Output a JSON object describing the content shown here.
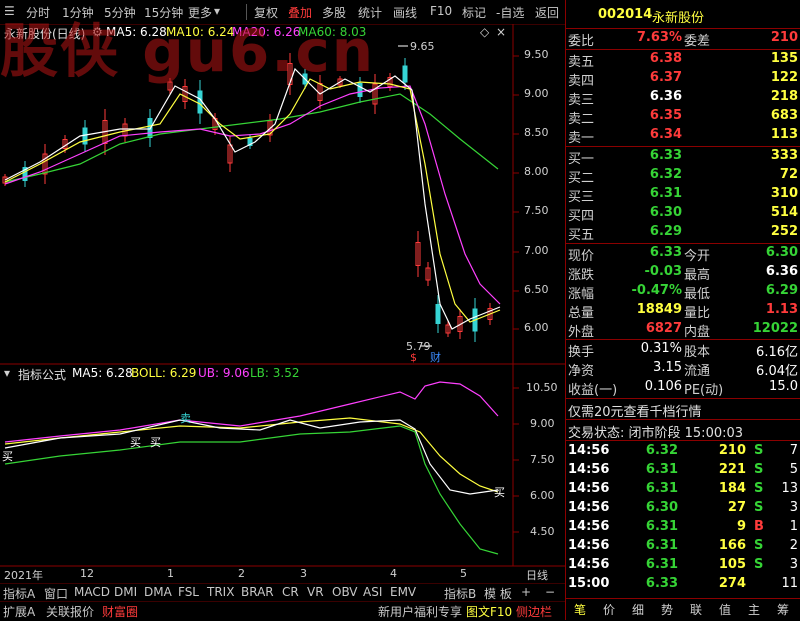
{
  "toolbar": {
    "items": [
      "分时",
      "1分钟",
      "5分钟",
      "15分钟",
      "更多",
      "复权",
      "叠加",
      "多股",
      "统计",
      "画线",
      "F10",
      "标记",
      "-自选",
      "返回"
    ]
  },
  "watermark": "股侠 gu6.cn",
  "chart": {
    "title": "永新股份(日线)",
    "ma5": "MA5: 6.28",
    "ma10": "MA10: 6.24",
    "ma20": "MA20: 6.26",
    "ma60": "MA60: 8.03",
    "high_marker": "9.65",
    "low_marker": "5.79",
    "price_axis": [
      "9.50",
      "9.00",
      "8.50",
      "8.00",
      "7.50",
      "7.00",
      "6.50",
      "6.00"
    ],
    "s_tag": "$",
    "cai_tag": "财"
  },
  "indicator": {
    "title": "指标公式",
    "ma5": "MA5: 6.28",
    "boll": "BOLL: 6.29",
    "ub": "UB: 9.06",
    "lb": "LB: 3.52",
    "axis": [
      "10.50",
      "9.00",
      "7.50",
      "6.00",
      "4.50"
    ],
    "buy": "买",
    "sell": "卖"
  },
  "time_axis": {
    "labels": [
      "2021年",
      "12",
      "1",
      "2",
      "3",
      "4",
      "5"
    ],
    "period": "日线"
  },
  "bottom_tabs": {
    "row1": [
      "指标A",
      "窗口",
      "MACD",
      "DMI",
      "DMA",
      "FSL",
      "TRIX",
      "BRAR",
      "CR",
      "VR",
      "OBV",
      "ASI",
      "EMV",
      "指标B",
      "模 板",
      "+",
      "−"
    ],
    "row2": [
      "扩展A",
      "关联报价",
      "财富圈"
    ],
    "right": [
      "新用户福利专享",
      "图文F10",
      "侧边栏"
    ]
  },
  "quote": {
    "code": "002014",
    "name": "永新股份",
    "weibi_label": "委比",
    "weibi": "7.63%",
    "weicha_label": "委差",
    "weicha": "210",
    "asks": [
      {
        "label": "卖五",
        "price": "6.38",
        "vol": "135"
      },
      {
        "label": "卖四",
        "price": "6.37",
        "vol": "122"
      },
      {
        "label": "卖三",
        "price": "6.36",
        "vol": "218"
      },
      {
        "label": "卖二",
        "price": "6.35",
        "vol": "683"
      },
      {
        "label": "卖一",
        "price": "6.34",
        "vol": "113"
      }
    ],
    "bids": [
      {
        "label": "买一",
        "price": "6.33",
        "vol": "333"
      },
      {
        "label": "买二",
        "price": "6.32",
        "vol": "72"
      },
      {
        "label": "买三",
        "price": "6.31",
        "vol": "310"
      },
      {
        "label": "买四",
        "price": "6.30",
        "vol": "514"
      },
      {
        "label": "买五",
        "price": "6.29",
        "vol": "252"
      }
    ],
    "stats": [
      {
        "l1": "现价",
        "v1": "6.33",
        "l2": "今开",
        "v2": "6.30"
      },
      {
        "l1": "涨跌",
        "v1": "-0.03",
        "l2": "最高",
        "v2": "6.36"
      },
      {
        "l1": "涨幅",
        "v1": "-0.47%",
        "l2": "最低",
        "v2": "6.29"
      },
      {
        "l1": "总量",
        "v1": "18849",
        "l2": "量比",
        "v2": "1.13"
      },
      {
        "l1": "外盘",
        "v1": "6827",
        "l2": "内盘",
        "v2": "12022"
      }
    ],
    "fund": [
      {
        "l1": "换手",
        "v1": "0.31%",
        "l2": "股本",
        "v2": "6.16亿"
      },
      {
        "l1": "净资",
        "v1": "3.15",
        "l2": "流通",
        "v2": "6.04亿"
      },
      {
        "l1": "收益(一)",
        "v1": "0.106",
        "l2": "PE(动)",
        "v2": "15.0"
      }
    ],
    "promo": "仅需20元查看千档行情",
    "status": "交易状态: 闭市阶段 15:00:03",
    "ticks": [
      {
        "t": "14:56",
        "p": "6.32",
        "v": "210",
        "d": "S",
        "n": "7"
      },
      {
        "t": "14:56",
        "p": "6.31",
        "v": "221",
        "d": "S",
        "n": "5"
      },
      {
        "t": "14:56",
        "p": "6.31",
        "v": "184",
        "d": "S",
        "n": "13"
      },
      {
        "t": "14:56",
        "p": "6.30",
        "v": "27",
        "d": "S",
        "n": "3"
      },
      {
        "t": "14:56",
        "p": "6.31",
        "v": "9",
        "d": "B",
        "n": "1"
      },
      {
        "t": "14:56",
        "p": "6.31",
        "v": "166",
        "d": "S",
        "n": "2"
      },
      {
        "t": "14:56",
        "p": "6.31",
        "v": "105",
        "d": "S",
        "n": "3"
      },
      {
        "t": "15:00",
        "p": "6.33",
        "v": "274",
        "d": "",
        "n": "11"
      }
    ],
    "bottom_tabs": [
      "笔",
      "价",
      "细",
      "势",
      "联",
      "值",
      "主",
      "筹"
    ]
  },
  "colors": {
    "ma5": "#ffffff",
    "ma10": "#ffff40",
    "ma20": "#ff40ff",
    "ma60": "#36d436",
    "up": "#ff3b3b",
    "down": "#36d4d4"
  }
}
